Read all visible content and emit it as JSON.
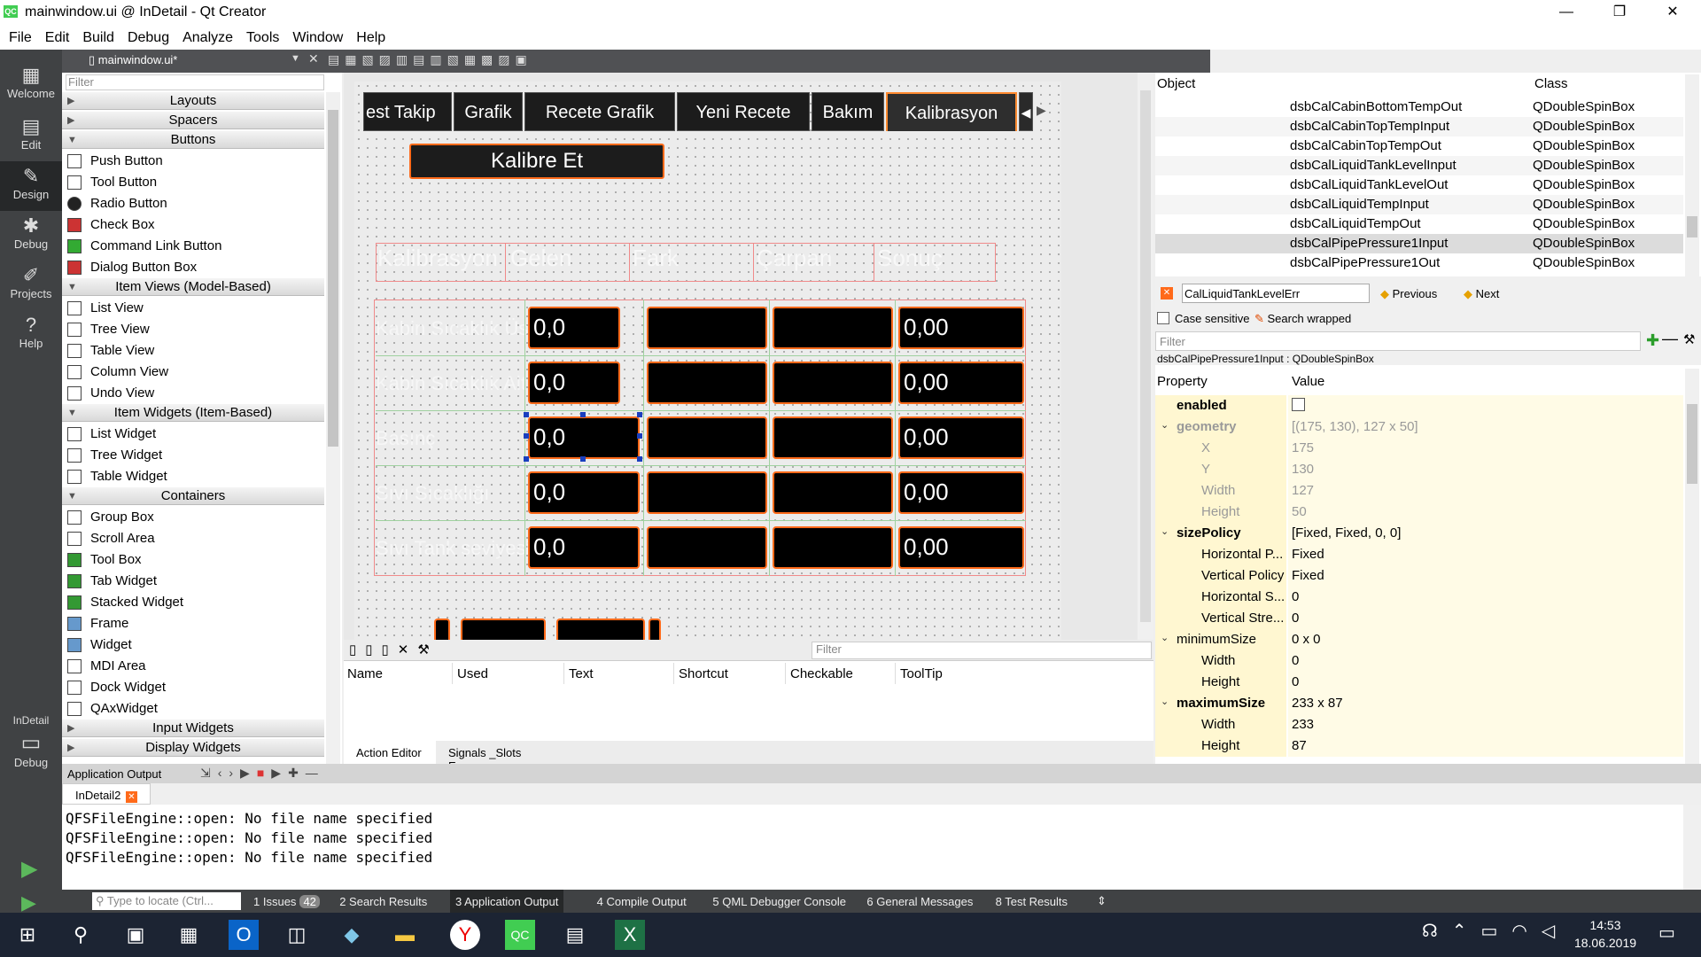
{
  "window": {
    "title": "mainwindow.ui @ InDetail - Qt Creator",
    "app_icon": "QC",
    "minimize": "—",
    "maximize": "❐",
    "close": "✕"
  },
  "menu": [
    "File",
    "Edit",
    "Build",
    "Debug",
    "Analyze",
    "Tools",
    "Window",
    "Help"
  ],
  "modes": [
    {
      "label": "Welcome",
      "icon": "▦"
    },
    {
      "label": "Edit",
      "icon": "▤"
    },
    {
      "label": "Design",
      "icon": "✎"
    },
    {
      "label": "Debug",
      "icon": "✱"
    },
    {
      "label": "Projects",
      "icon": "✐"
    },
    {
      "label": "Help",
      "icon": "?"
    }
  ],
  "kit": {
    "label": "InDetail",
    "sub": "Debug"
  },
  "editor_tab": {
    "filename": "mainwindow.ui*"
  },
  "widgetbox": {
    "filter_placeholder": "Filter",
    "items": [
      {
        "type": "cat",
        "label": "Layouts",
        "open": false
      },
      {
        "type": "cat",
        "label": "Spacers",
        "open": false
      },
      {
        "type": "cat",
        "label": "Buttons",
        "open": true
      },
      {
        "type": "item",
        "label": "Push Button"
      },
      {
        "type": "item",
        "label": "Tool Button"
      },
      {
        "type": "item",
        "label": "Radio Button"
      },
      {
        "type": "item",
        "label": "Check Box"
      },
      {
        "type": "item",
        "label": "Command Link Button"
      },
      {
        "type": "item",
        "label": "Dialog Button Box"
      },
      {
        "type": "cat",
        "label": "Item Views (Model-Based)",
        "open": true
      },
      {
        "type": "item",
        "label": "List View"
      },
      {
        "type": "item",
        "label": "Tree View"
      },
      {
        "type": "item",
        "label": "Table View"
      },
      {
        "type": "item",
        "label": "Column View"
      },
      {
        "type": "item",
        "label": "Undo View"
      },
      {
        "type": "cat",
        "label": "Item Widgets (Item-Based)",
        "open": true
      },
      {
        "type": "item",
        "label": "List Widget"
      },
      {
        "type": "item",
        "label": "Tree Widget"
      },
      {
        "type": "item",
        "label": "Table Widget"
      },
      {
        "type": "cat",
        "label": "Containers",
        "open": true
      },
      {
        "type": "item",
        "label": "Group Box"
      },
      {
        "type": "item",
        "label": "Scroll Area"
      },
      {
        "type": "item",
        "label": "Tool Box"
      },
      {
        "type": "item",
        "label": "Tab Widget"
      },
      {
        "type": "item",
        "label": "Stacked Widget"
      },
      {
        "type": "item",
        "label": "Frame"
      },
      {
        "type": "item",
        "label": "Widget"
      },
      {
        "type": "item",
        "label": "MDI Area"
      },
      {
        "type": "item",
        "label": "Dock Widget"
      },
      {
        "type": "item",
        "label": "QAxWidget"
      },
      {
        "type": "cat",
        "label": "Input Widgets",
        "open": false
      },
      {
        "type": "cat",
        "label": "Display Widgets",
        "open": false
      }
    ]
  },
  "form": {
    "tabs": [
      "est Takip",
      "Grafik",
      "Recete Grafik",
      "Yeni Recete",
      "Bakım",
      "Kalibrasyon"
    ],
    "selected_tab": "Kalibrasyon",
    "calibrate_button": "Kalibre Et",
    "headers": [
      "Kalibrasyon",
      "Gelen",
      "Fark",
      "Çarpan",
      "Sonuç"
    ],
    "rows": [
      {
        "label": "Kabin Sıcaklık Üst",
        "gelen": "0,0",
        "sonuc": "0,00"
      },
      {
        "label": "Kabin Sıcaklık Alt",
        "gelen": "0,0",
        "sonuc": "0,00"
      },
      {
        "label": "Basınç",
        "gelen": "0,0",
        "sonuc": "0,00"
      },
      {
        "label": "Sıvı Sıcaklığı",
        "gelen": "0,0",
        "sonuc": "0,00"
      },
      {
        "label": "Sıvı Tank seviyesi",
        "gelen": "0,0",
        "sonuc": "0,00"
      }
    ]
  },
  "action_editor": {
    "filter_placeholder": "Filter",
    "columns": [
      "Name",
      "Used",
      "Text",
      "Shortcut",
      "Checkable",
      "ToolTip"
    ],
    "tabs": [
      "Action Editor",
      "Signals _Slots E..."
    ]
  },
  "object_inspector": {
    "columns": [
      "Object",
      "Class"
    ],
    "rows": [
      {
        "name": "dsbCalCabinBottomTempOut",
        "class": "QDoubleSpinBox"
      },
      {
        "name": "dsbCalCabinTopTempInput",
        "class": "QDoubleSpinBox"
      },
      {
        "name": "dsbCalCabinTopTempOut",
        "class": "QDoubleSpinBox"
      },
      {
        "name": "dsbCalLiquidTankLevelInput",
        "class": "QDoubleSpinBox"
      },
      {
        "name": "dsbCalLiquidTankLevelOut",
        "class": "QDoubleSpinBox"
      },
      {
        "name": "dsbCalLiquidTempInput",
        "class": "QDoubleSpinBox"
      },
      {
        "name": "dsbCalLiquidTempOut",
        "class": "QDoubleSpinBox"
      },
      {
        "name": "dsbCalPipePressure1Input",
        "class": "QDoubleSpinBox",
        "selected": true
      },
      {
        "name": "dsbCalPipePressure1Out",
        "class": "QDoubleSpinBox"
      }
    ],
    "find_value": "CalLiquidTankLevelErr",
    "previous": "Previous",
    "next": "Next",
    "case_sensitive": "Case sensitive",
    "search_wrapped": "Search wrapped"
  },
  "property_editor": {
    "filter_placeholder": "Filter",
    "object_title": "dsbCalPipePressure1Input : QDoubleSpinBox",
    "columns": [
      "Property",
      "Value"
    ],
    "rows": [
      {
        "name": "enabled",
        "value": "",
        "bold": true,
        "indent": 0,
        "checkbox": true
      },
      {
        "name": "geometry",
        "value": "[(175, 130), 127 x 50]",
        "bold": true,
        "indent": 0,
        "expander": true,
        "dim": true
      },
      {
        "name": "X",
        "value": "175",
        "indent": 1,
        "dim": true
      },
      {
        "name": "Y",
        "value": "130",
        "indent": 1,
        "dim": true
      },
      {
        "name": "Width",
        "value": "127",
        "indent": 1,
        "dim": true
      },
      {
        "name": "Height",
        "value": "50",
        "indent": 1,
        "dim": true
      },
      {
        "name": "sizePolicy",
        "value": "[Fixed, Fixed, 0, 0]",
        "bold": true,
        "indent": 0,
        "expander": true
      },
      {
        "name": "Horizontal P...",
        "value": "Fixed",
        "indent": 1
      },
      {
        "name": "Vertical Policy",
        "value": "Fixed",
        "indent": 1
      },
      {
        "name": "Horizontal S...",
        "value": "0",
        "indent": 1
      },
      {
        "name": "Vertical Stre...",
        "value": "0",
        "indent": 1
      },
      {
        "name": "minimumSize",
        "value": "0 x 0",
        "indent": 0,
        "expander": true
      },
      {
        "name": "Width",
        "value": "0",
        "indent": 1
      },
      {
        "name": "Height",
        "value": "0",
        "indent": 1
      },
      {
        "name": "maximumSize",
        "value": "233 x 87",
        "bold": true,
        "indent": 0,
        "expander": true
      },
      {
        "name": "Width",
        "value": "233",
        "indent": 1
      },
      {
        "name": "Height",
        "value": "87",
        "indent": 1
      }
    ]
  },
  "output": {
    "title": "Application Output",
    "tab": "InDetail2",
    "lines": [
      "QFSFileEngine::open: No file name specified",
      "QFSFileEngine::open: No file name specified",
      "QFSFileEngine::open: No file name specified"
    ]
  },
  "statusbar": {
    "locate_placeholder": "Type to locate (Ctrl...",
    "panes": [
      {
        "num": "1",
        "label": "Issues",
        "badge": "42"
      },
      {
        "num": "2",
        "label": "Search Results"
      },
      {
        "num": "3",
        "label": "Application Output",
        "active": true
      },
      {
        "num": "4",
        "label": "Compile Output"
      },
      {
        "num": "5",
        "label": "QML Debugger Console"
      },
      {
        "num": "6",
        "label": "General Messages"
      },
      {
        "num": "8",
        "label": "Test Results"
      }
    ]
  },
  "taskbar": {
    "time": "14:53",
    "date": "18.06.2019"
  }
}
